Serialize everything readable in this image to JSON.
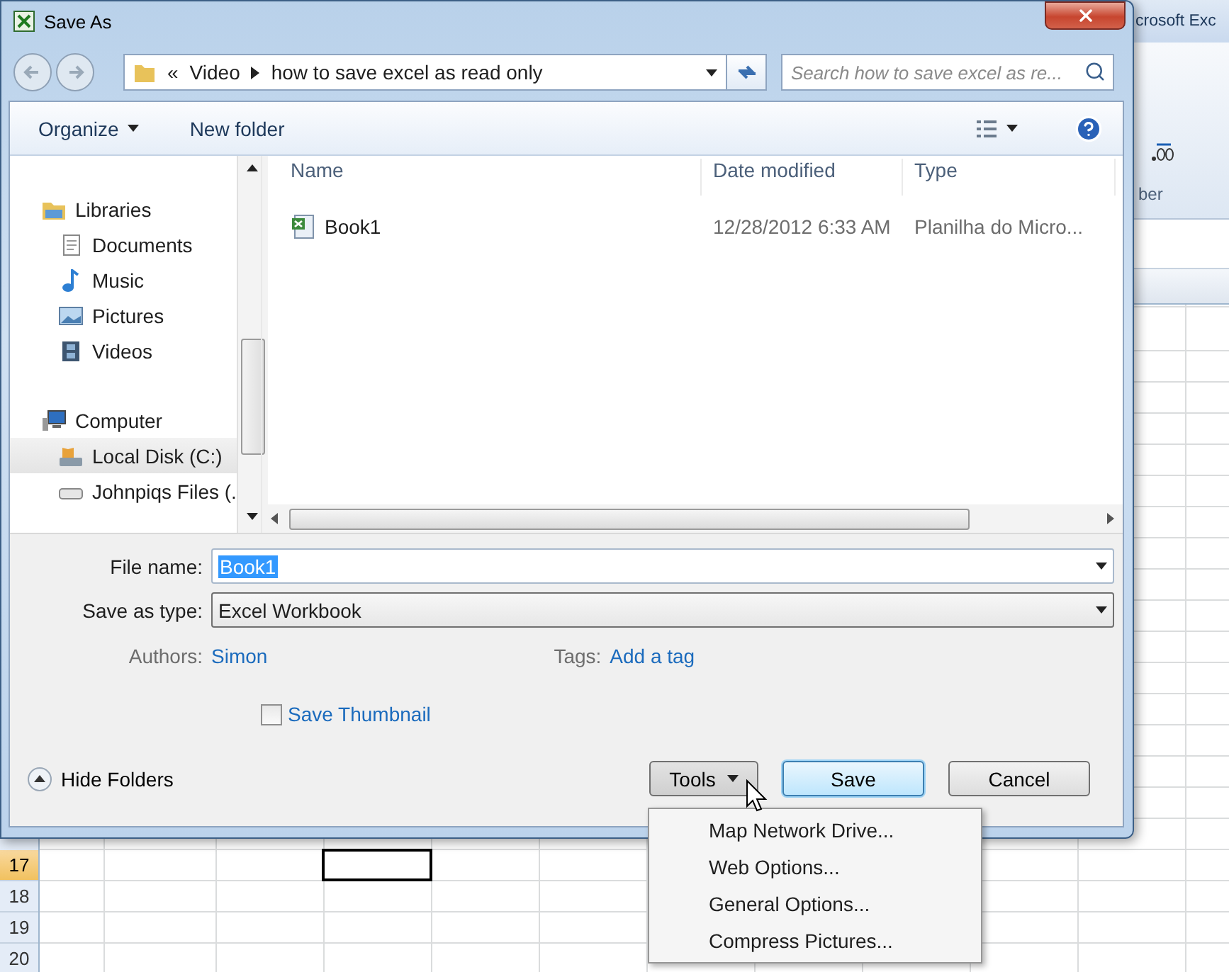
{
  "excel": {
    "title_fragment": "crosoft Exc",
    "ribbon_group_fragment": "ber",
    "rows": [
      {
        "label": "17",
        "selected": true
      },
      {
        "label": "18",
        "selected": false
      },
      {
        "label": "19",
        "selected": false
      },
      {
        "label": "20",
        "selected": false
      }
    ]
  },
  "dialog": {
    "title": "Save As",
    "address": {
      "overflow": "«",
      "segments": [
        "Video",
        "how to save excel as read only"
      ]
    },
    "search": {
      "placeholder": "Search how to save excel as re..."
    },
    "toolbar": {
      "organize": "Organize",
      "new_folder": "New folder"
    },
    "navigation": [
      {
        "label": "Libraries",
        "kind": "library",
        "selected": false,
        "children": [
          {
            "label": "Documents",
            "kind": "documents",
            "selected": false
          },
          {
            "label": "Music",
            "kind": "music",
            "selected": false
          },
          {
            "label": "Pictures",
            "kind": "pictures",
            "selected": false
          },
          {
            "label": "Videos",
            "kind": "videos",
            "selected": false
          }
        ]
      },
      {
        "label": "Computer",
        "kind": "computer",
        "selected": false,
        "children": [
          {
            "label": "Local Disk (C:)",
            "kind": "disk",
            "selected": true
          },
          {
            "label": "Johnpiqs Files (.",
            "kind": "drive",
            "selected": false
          }
        ]
      }
    ],
    "columns": [
      "Name",
      "Date modified",
      "Type"
    ],
    "files": [
      {
        "name": "Book1",
        "date_modified": "12/28/2012 6:33 AM",
        "type": "Planilha do Micro..."
      }
    ],
    "file_name": {
      "label": "File name:",
      "value": "Book1"
    },
    "save_as_type": {
      "label": "Save as type:",
      "value": "Excel Workbook"
    },
    "authors": {
      "label": "Authors:",
      "value": "Simon"
    },
    "tags": {
      "label": "Tags:",
      "value": "Add a tag"
    },
    "save_thumbnail": {
      "label": "Save Thumbnail",
      "checked": false
    },
    "hide_folders": "Hide Folders",
    "buttons": [
      {
        "label": "Tools",
        "kind": "menu"
      },
      {
        "label": "Save",
        "kind": "default"
      },
      {
        "label": "Cancel",
        "kind": "plain"
      }
    ],
    "tools_menu": [
      "Map Network Drive...",
      "Web Options...",
      "General Options...",
      "Compress Pictures..."
    ]
  }
}
